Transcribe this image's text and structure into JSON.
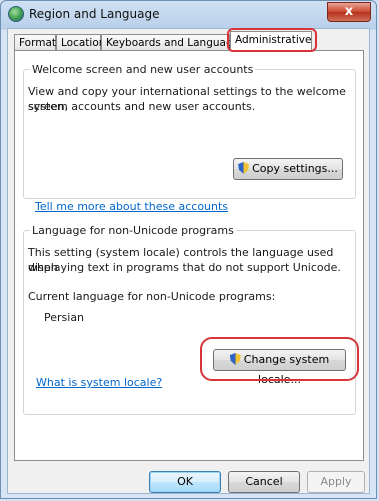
{
  "window": {
    "title": "Region and Language",
    "close_glyph": "x"
  },
  "tabs": [
    {
      "label": "Formats"
    },
    {
      "label": "Location"
    },
    {
      "label": "Keyboards and Languages"
    },
    {
      "label": "Administrative"
    }
  ],
  "welcome_group": {
    "legend": "Welcome screen and new user accounts",
    "description_line1": "View and copy your international settings to the welcome screen,",
    "description_line2": "system accounts and new user accounts.",
    "copy_button": "Copy settings...",
    "link": "Tell me more about these accounts"
  },
  "unicode_group": {
    "legend": "Language for non-Unicode programs",
    "description_line1": "This setting (system locale) controls the language used when",
    "description_line2": "displaying text in programs that do not support Unicode.",
    "current_label": "Current language for non-Unicode programs:",
    "current_value": "Persian",
    "change_button": "Change system locale...",
    "link": "What is system locale?"
  },
  "footer": {
    "ok": "OK",
    "cancel": "Cancel",
    "apply": "Apply"
  },
  "colors": {
    "highlight": "#d7353a",
    "link": "#0066cc"
  }
}
